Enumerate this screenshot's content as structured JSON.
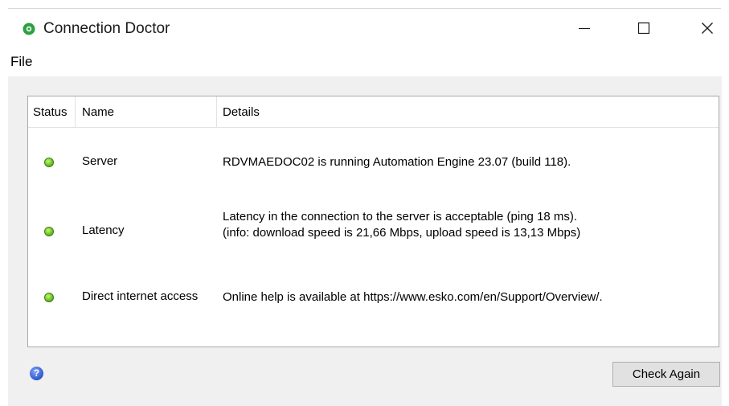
{
  "window": {
    "title": "Connection Doctor",
    "app_icon": "gear-status-icon",
    "controls": [
      "minimize-icon",
      "maximize-icon",
      "close-icon"
    ]
  },
  "menu": {
    "file_label": "File"
  },
  "table": {
    "columns": {
      "status": "Status",
      "name": "Name",
      "details": "Details"
    },
    "rows": [
      {
        "status_color": "#6cc52a",
        "name": "Server",
        "details": [
          "RDVMAEDOC02 is running Automation Engine 23.07 (build 118)."
        ]
      },
      {
        "status_color": "#6cc52a",
        "name": "Latency",
        "details": [
          "Latency in the connection to the server is acceptable (ping 18 ms).",
          "(info: download speed is 21,66 Mbps, upload speed is 13,13 Mbps)"
        ]
      },
      {
        "status_color": "#6cc52a",
        "name": "Direct internet access",
        "details": [
          "Online help is available at https://www.esko.com/en/Support/Overview/."
        ]
      }
    ]
  },
  "footer": {
    "help_icon": "help-icon",
    "help_glyph": "?",
    "check_again_label": "Check Again"
  }
}
